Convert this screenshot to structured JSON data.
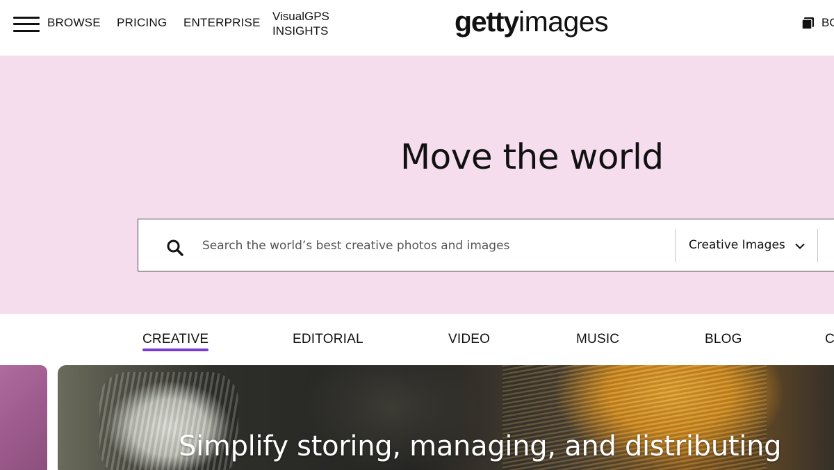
{
  "header": {
    "nav": {
      "browse": "BROWSE",
      "pricing": "PRICING",
      "enterprise": "ENTERPRISE",
      "visualgps_line1": "VisualGPS",
      "visualgps_line2": "INSIGHTS"
    },
    "logo": {
      "part1": "getty",
      "part2": "images"
    },
    "boards_label": "BO",
    "icons": {
      "menu": "hamburger-menu-icon",
      "boards": "boards-icon"
    }
  },
  "hero": {
    "title": "Move the world",
    "background_color": "#f5dded",
    "search": {
      "placeholder": "Search the world’s best creative photos and images",
      "value": "",
      "type_selected": "Creative Images",
      "icons": {
        "search": "search-icon",
        "dropdown": "chevron-down-icon"
      }
    }
  },
  "tabs": {
    "items": [
      {
        "label": "CREATIVE",
        "active": true
      },
      {
        "label": "EDITORIAL",
        "active": false
      },
      {
        "label": "VIDEO",
        "active": false
      },
      {
        "label": "MUSIC",
        "active": false
      },
      {
        "label": "BLOG",
        "active": false
      },
      {
        "label": "C",
        "active": false
      }
    ],
    "accent_color": "#7a3bd0"
  },
  "feature": {
    "headline": "Simplify storing, managing, and distributing"
  }
}
